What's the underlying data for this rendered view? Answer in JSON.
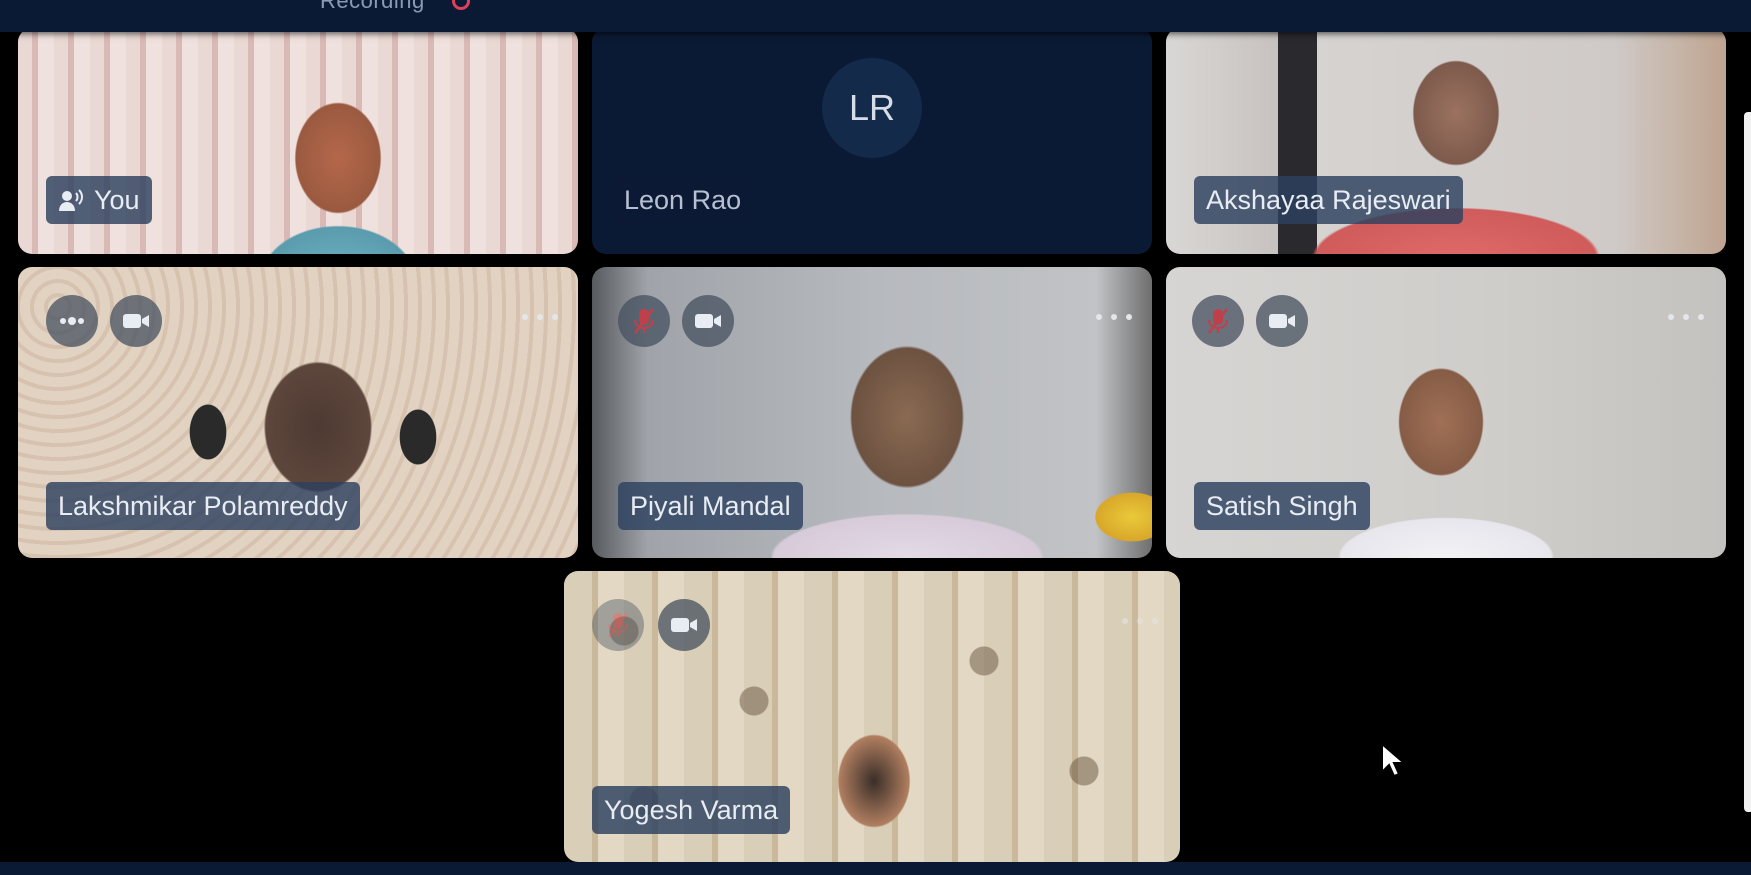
{
  "header": {
    "recording_label": "Recording"
  },
  "participants": [
    {
      "name": "You",
      "initials": ""
    },
    {
      "name": "Leon Rao",
      "initials": "LR"
    },
    {
      "name": "Akshayaa Rajeswari",
      "initials": ""
    },
    {
      "name": "Lakshmikar Polamreddy",
      "initials": ""
    },
    {
      "name": "Piyali Mandal",
      "initials": ""
    },
    {
      "name": "Satish Singh",
      "initials": ""
    },
    {
      "name": "Yogesh Varma",
      "initials": ""
    }
  ],
  "icons": {
    "speaking": "speaking-icon",
    "mic_muted": "mic-muted-icon",
    "audio_level": "audio-level-icon",
    "camera": "camera-icon",
    "more": "more-options-icon",
    "cursor": "mouse-cursor-icon"
  },
  "colors": {
    "background": "#000000",
    "bar": "#0b1a34",
    "mic_muted": "#c0404a",
    "recording_dot": "#e0405a"
  }
}
